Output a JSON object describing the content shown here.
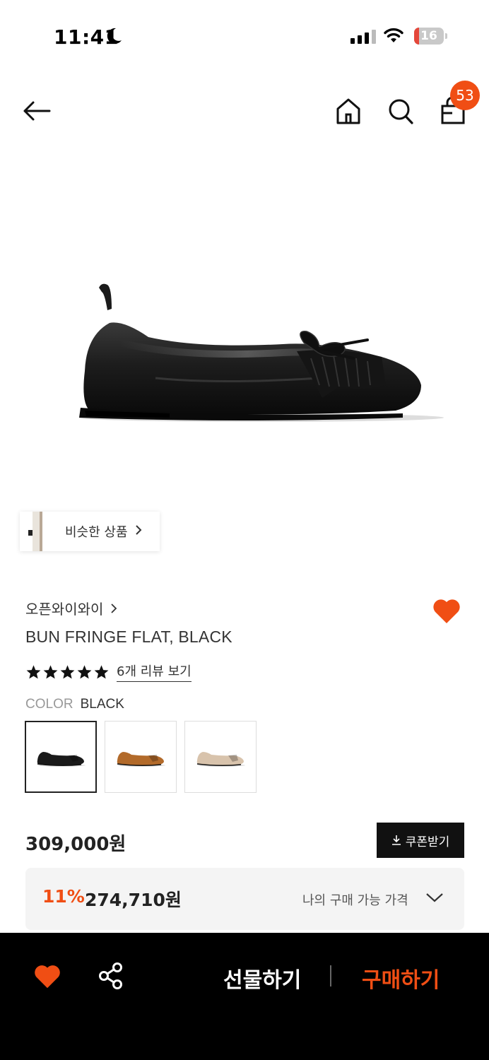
{
  "status_bar": {
    "time": "11:41",
    "battery_level": "16",
    "icons": [
      "moon-icon",
      "signal-icon",
      "wifi-icon",
      "battery-icon"
    ]
  },
  "nav": {
    "icons": [
      "back-arrow-icon",
      "home-icon",
      "search-icon",
      "shopping-bag-icon"
    ],
    "cart_count": "53"
  },
  "similar_products": {
    "label": "비슷한 상품"
  },
  "product": {
    "brand": "오픈와이와이",
    "title": "BUN FRINGE FLAT, BLACK",
    "rating_stars": 5,
    "review_link": "6개 리뷰 보기",
    "color_label": "COLOR",
    "color_value": "BLACK",
    "swatches": [
      {
        "name": "black",
        "color": "#1a1a1a",
        "selected": true
      },
      {
        "name": "tan",
        "color": "#b26a2a",
        "selected": false
      },
      {
        "name": "beige",
        "color": "#d8c3ac",
        "selected": false
      }
    ]
  },
  "price": {
    "original": "309,000원",
    "coupon_button": "쿠폰받기",
    "discount_rate": "11%",
    "sale_price": "274,710원",
    "my_price_label": "나의 구매 가능 가격"
  },
  "bottom_bar": {
    "gift_label": "선물하기",
    "buy_label": "구매하기"
  },
  "colors": {
    "accent": "#f04e14",
    "bottom_bar": "#000000",
    "coupon_button": "#111111"
  }
}
